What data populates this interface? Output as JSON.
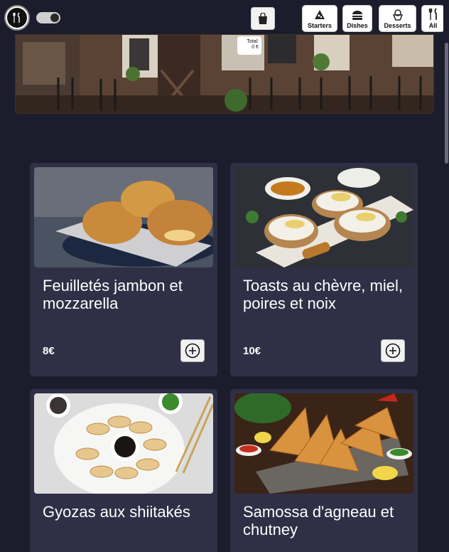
{
  "header": {
    "categories": [
      {
        "label": "Starters",
        "icon": "pizza-icon"
      },
      {
        "label": "Dishes",
        "icon": "burger-icon"
      },
      {
        "label": "Desserts",
        "icon": "ice-cream-icon"
      },
      {
        "label": "All",
        "icon": "cutlery-icon"
      }
    ]
  },
  "cart": {
    "total_label": "Total:",
    "total_value": "0 €"
  },
  "products": [
    {
      "name": "Feuilletés jambon et mozzarella",
      "price": "8€"
    },
    {
      "name": "Toasts au chèvre, miel, poires et noix",
      "price": "10€"
    },
    {
      "name": "Gyozas aux shiitakés",
      "price": ""
    },
    {
      "name": "Samossa d'agneau et chutney",
      "price": ""
    }
  ],
  "colors": {
    "background": "#1c1d2c",
    "card": "#2f3045",
    "button": "#f1f1f1"
  }
}
